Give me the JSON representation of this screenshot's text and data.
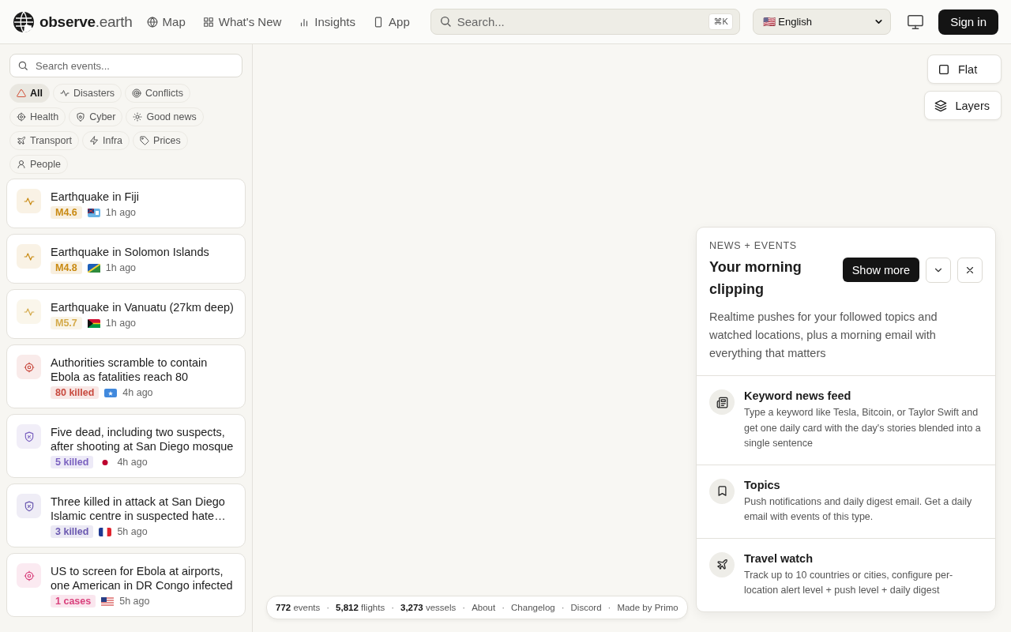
{
  "header": {
    "logo": {
      "word": "observe",
      "suffix": ".earth"
    },
    "nav": [
      {
        "label": "Map"
      },
      {
        "label": "What's New"
      },
      {
        "label": "Insights"
      },
      {
        "label": "App"
      }
    ],
    "search": {
      "placeholder": "Search...",
      "shortcut": "⌘K"
    },
    "language": {
      "flag": "🇺🇸",
      "value": "English"
    },
    "sign_in": "Sign in"
  },
  "sidebar": {
    "search": {
      "placeholder": "Search events..."
    },
    "filters": [
      {
        "label": "All",
        "kind": "all",
        "selected": true
      },
      {
        "label": "Disasters",
        "kind": "pulse",
        "selected": false
      },
      {
        "label": "Conflicts",
        "kind": "target",
        "selected": false
      },
      {
        "label": "Health",
        "kind": "crosshair",
        "selected": false
      },
      {
        "label": "Cyber",
        "kind": "shield",
        "selected": false
      },
      {
        "label": "Good news",
        "kind": "sun",
        "selected": false
      },
      {
        "label": "Transport",
        "kind": "plane",
        "selected": false
      },
      {
        "label": "Infra",
        "kind": "bolt",
        "selected": false
      },
      {
        "label": "Prices",
        "kind": "tag",
        "selected": false
      },
      {
        "label": "People",
        "kind": "person",
        "selected": false
      }
    ],
    "events": [
      {
        "title": "Earthquake in Fiji",
        "kind": "disaster",
        "badge": "M4.6",
        "color": "#c98a12",
        "time": "1h ago"
      },
      {
        "title": "Earthquake in Solomon Islands",
        "kind": "disaster",
        "badge": "M4.8",
        "color": "#c98a12",
        "time": "1h ago"
      },
      {
        "title": "Earthquake in Vanuatu (27km deep)",
        "kind": "disaster",
        "badge": "M5.7",
        "color": "#d4aa4a",
        "time": "1h ago"
      },
      {
        "title": "Authorities scramble to contain Ebola as fatalities reach 80",
        "kind": "health",
        "badge": "80 killed",
        "color": "#c8493e",
        "time": "4h ago"
      },
      {
        "title": "Five dead, including two suspects, after shooting at San Diego mosque",
        "kind": "conflict",
        "badge": "5 killed",
        "color": "#7b62c0",
        "time": "4h ago"
      },
      {
        "title": "Three killed in attack at San Diego Islamic centre in suspected hate…",
        "kind": "conflict",
        "badge": "3 killed",
        "color": "#6a58b0",
        "time": "5h ago"
      },
      {
        "title": "US to screen for Ebola at airports, one American in DR Congo infected",
        "kind": "health",
        "badge": "1 cases",
        "color": "#d9427d",
        "time": "5h ago"
      }
    ]
  },
  "map_controls": [
    {
      "label": "Flat"
    },
    {
      "label": "Layers"
    }
  ],
  "panel": {
    "eyebrow": "NEWS + EVENTS",
    "title": "Your morning clipping",
    "show_more": "Show more",
    "description": "Realtime pushes for your followed topics and watched locations, plus a morning email with everything that matters",
    "features": [
      {
        "title": "Keyword news feed",
        "text": "Type a keyword like Tesla, Bitcoin, or Taylor Swift and get one daily card with the day's stories blended into a single sentence"
      },
      {
        "title": "Topics",
        "text": "Push notifications and daily digest email. Get a daily email with events of this type."
      },
      {
        "title": "Travel watch",
        "text": "Track up to 10 countries or cities, configure per-location alert level + push level + daily digest"
      }
    ]
  },
  "footer": {
    "separator": "·",
    "stats": [
      {
        "number": "772",
        "label": "events"
      },
      {
        "number": "5,812",
        "label": "flights"
      },
      {
        "number": "3,273",
        "label": "vessels"
      }
    ],
    "links": [
      "About",
      "Changelog",
      "Discord",
      "Made by Primo"
    ]
  }
}
